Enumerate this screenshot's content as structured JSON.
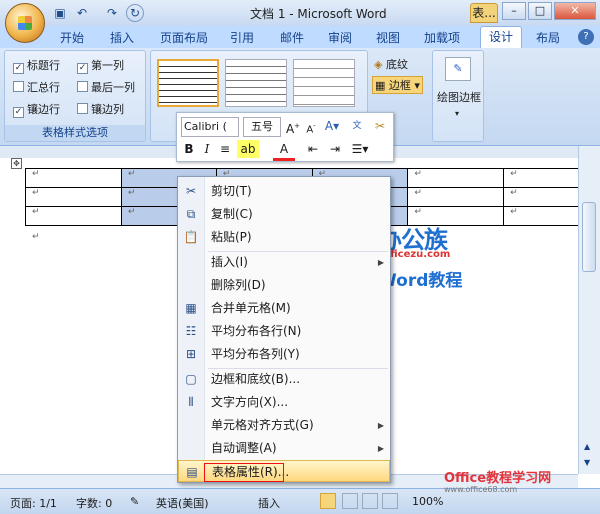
{
  "window": {
    "title": "文档 1 - Microsoft Word",
    "context_tab": "表..."
  },
  "qat": {
    "save_icon": "save-icon",
    "undo_icon": "undo-icon",
    "redo_icon": "redo-icon"
  },
  "tabs": [
    "开始",
    "插入",
    "页面布局",
    "引用",
    "邮件",
    "审阅",
    "视图",
    "加载项",
    "设计",
    "布局"
  ],
  "table_style_options": {
    "caption": "表格样式选项",
    "options": [
      {
        "label": "标题行",
        "checked": true
      },
      {
        "label": "第一列",
        "checked": true
      },
      {
        "label": "汇总行",
        "checked": false
      },
      {
        "label": "最后一列",
        "checked": false
      },
      {
        "label": "镶边行",
        "checked": true
      },
      {
        "label": "镶边列",
        "checked": false
      }
    ]
  },
  "ribbon": {
    "shading": "底纹",
    "borders": "边框",
    "draw_borders": "绘图边框"
  },
  "mini_toolbar": {
    "font": "Calibri (",
    "size": "五号",
    "bold": "B",
    "italic": "I",
    "font_color": "A"
  },
  "context_menu": {
    "items": [
      {
        "label": "剪切(T)",
        "icon": "scissors-icon"
      },
      {
        "label": "复制(C)",
        "icon": "copy-icon"
      },
      {
        "label": "粘贴(P)",
        "icon": "paste-icon"
      },
      {
        "label": "插入(I)",
        "icon": ""
      },
      {
        "label": "删除列(D)",
        "icon": ""
      },
      {
        "label": "合并单元格(M)",
        "icon": "merge-cells-icon"
      },
      {
        "label": "平均分布各行(N)",
        "icon": "distribute-rows-icon"
      },
      {
        "label": "平均分布各列(Y)",
        "icon": "distribute-columns-icon"
      },
      {
        "label": "边框和底纹(B)...",
        "icon": "borders-shading-icon"
      },
      {
        "label": "文字方向(X)...",
        "icon": "text-direction-icon"
      },
      {
        "label": "单元格对齐方式(G)",
        "icon": ""
      },
      {
        "label": "自动调整(A)",
        "icon": ""
      },
      {
        "label": "表格属性(R)...",
        "icon": "table-properties-icon"
      }
    ]
  },
  "status": {
    "page": "页面: 1/1",
    "words": "字数: 0",
    "language": "英语(美国)",
    "mode": "插入",
    "zoom": "100%"
  },
  "watermark": {
    "brand": "办公族",
    "site": "Officezu.com",
    "subtitle": "Word教程",
    "corner": "Office教程学习网",
    "corner_url": "www.office68.com"
  }
}
